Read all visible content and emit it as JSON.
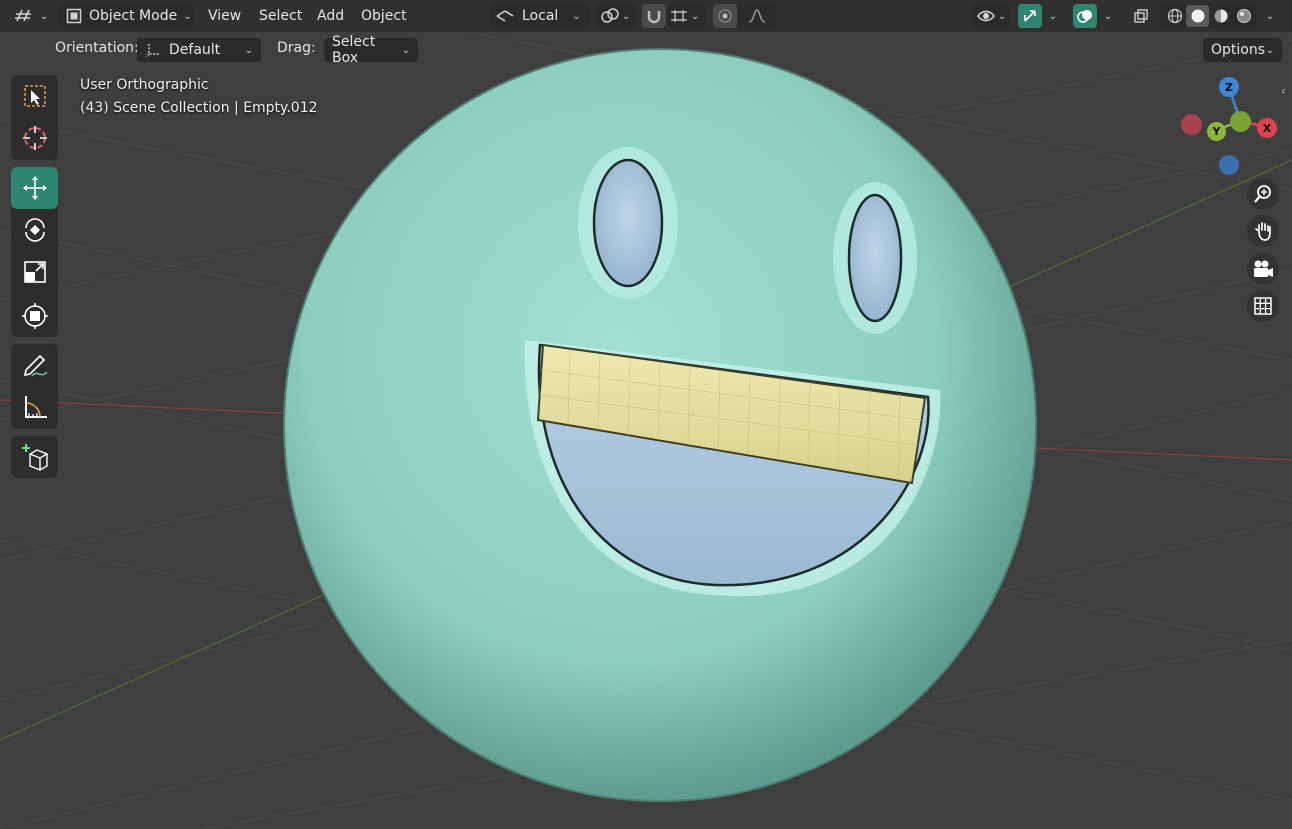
{
  "header": {
    "mode_label": "Object Mode",
    "menus": [
      "View",
      "Select",
      "Add",
      "Object"
    ],
    "transform_pivot": "Local",
    "options_label": "Options"
  },
  "tool_settings": {
    "orientation_label": "Orientation:",
    "orientation_value": "Default",
    "drag_label": "Drag:",
    "drag_value": "Select Box"
  },
  "viewport_overlay": {
    "view_name": "User Orthographic",
    "scene_info": "(43) Scene Collection | Empty.012"
  },
  "toolbar": {
    "tools": [
      "select-box",
      "cursor",
      "move",
      "rotate",
      "scale",
      "transform",
      "annotate",
      "measure",
      "add-cube"
    ],
    "active_tool": "move"
  },
  "gizmo": {
    "z": "Z",
    "y": "Y",
    "x": "X"
  },
  "colors": {
    "accent": "#2e8570",
    "object_body": "#8fd1c2",
    "teeth": "#e0dc9a",
    "mouth": "#a7c4da",
    "x_axis": "#e0434f",
    "y_axis": "#8cb83b",
    "z_axis": "#3f87d6"
  }
}
